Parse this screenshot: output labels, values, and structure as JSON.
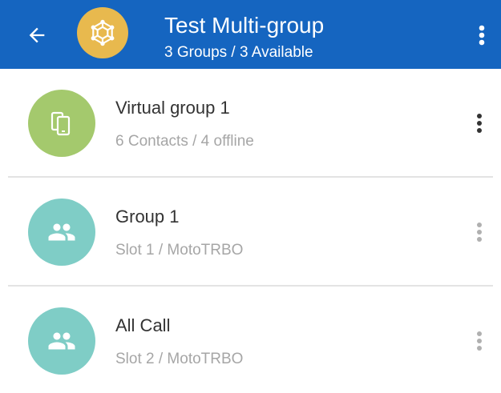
{
  "header": {
    "title": "Test Multi-group",
    "subtitle": "3 Groups /  3 Available",
    "background_color": "#1565c0",
    "avatar_color": "#e8b94e",
    "avatar_icon": "network-hub-icon",
    "back_icon": "arrow-back-icon",
    "menu_icon": "more-vertical-icon"
  },
  "groups": [
    {
      "title": "Virtual group 1",
      "subtitle": "6 Contacts / 4 offline",
      "avatar_color": "#a4c96d",
      "icon": "devices-icon",
      "menu_active": true
    },
    {
      "title": "Group 1",
      "subtitle": "Slot 1 / MotoTRBO",
      "avatar_color": "#7fcdc6",
      "icon": "group-icon",
      "menu_active": false
    },
    {
      "title": "All Call",
      "subtitle": "Slot 2 / MotoTRBO",
      "avatar_color": "#7fcdc6",
      "icon": "group-icon",
      "menu_active": false
    }
  ]
}
